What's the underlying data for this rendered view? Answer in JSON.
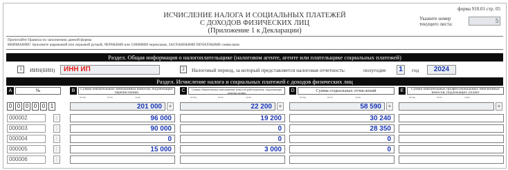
{
  "header": {
    "form_code": "форма  910.01  стр.  05",
    "title_line1": "ИСЧИСЛЕНИЕ НАЛОГА И СОЦИАЛЬНЫХ ПЛАТЕЖЕЙ",
    "title_line2": "С ДОХОДОВ ФИЗИЧЕСКИХ ЛИЦ",
    "title_line3": "(Приложение 1 к Декларации)",
    "sheet_label": "Укажите номер текущего листа:",
    "sheet_value": "5"
  },
  "notice": {
    "line1": "Прочитайте Правила по заполнению данной формы",
    "line2": "ВНИМАНИЕ! Заполните шариковой или перьевой ручкой, ЧЕРНЫМИ или СИНИМИ чернилами, ЗАГЛАВНЫМИ ПЕЧАТНЫМИ символами"
  },
  "section1": {
    "title": "Раздел. Общая информация о налогоплательщике (налоговом агенте, агенте или плательщике социальных платежей)",
    "iin_num": "1",
    "iin_label": "ИИН(БИН)",
    "iin_value": "ИНН ИП",
    "period_num": "2",
    "period_label": "Налоговый период, за который представляется налоговая отчетность:",
    "half_label": "полугодие",
    "half_value": "1",
    "year_label": "год",
    "year_value": "2024"
  },
  "section2": {
    "title": "Раздел. Исчисление налога и социальных платежей с доходов физических лиц"
  },
  "columns": [
    {
      "letter": "A",
      "head": "№"
    },
    {
      "letter": "B",
      "head": "Сумма обязательных пенсионных взносов, подлежащих перечислению"
    },
    {
      "letter": "C",
      "head": "Сумма обязательных пенсионных взносов работодателя, подлежащих перечислению"
    },
    {
      "letter": "D",
      "head": "Сумма социальных отчислений"
    },
    {
      "letter": "E",
      "head": "Сумма обязательных профессиональных пенсионных взносов, подлежащих уплате"
    }
  ],
  "subheads": [
    "месяц",
    "всего",
    "сумм"
  ],
  "num_boxes": [
    "0",
    "0",
    "0",
    "0",
    "0",
    "1"
  ],
  "totals": [
    "201 000",
    "22 200",
    "58 590",
    ""
  ],
  "plus_label": "+",
  "rows": [
    {
      "num": "000002",
      "values": [
        "96 000",
        "19 200",
        "30 240",
        ""
      ]
    },
    {
      "num": "000003",
      "values": [
        "90 000",
        "0",
        "28 350",
        ""
      ]
    },
    {
      "num": "000004",
      "values": [
        "0",
        "0",
        "0",
        ""
      ]
    },
    {
      "num": "000005",
      "values": [
        "15 000",
        "3 000",
        "0",
        ""
      ]
    },
    {
      "num": "000006",
      "values": [
        "",
        "",
        "",
        ""
      ]
    }
  ]
}
